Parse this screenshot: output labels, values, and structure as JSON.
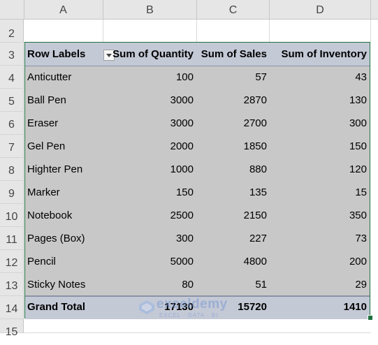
{
  "columns": [
    "A",
    "B",
    "C",
    "D"
  ],
  "rows": [
    "2",
    "3",
    "4",
    "5",
    "6",
    "7",
    "8",
    "9",
    "10",
    "11",
    "12",
    "13",
    "14",
    "15"
  ],
  "pivot": {
    "header": {
      "row_labels": "Row Labels",
      "qty": "Sum of Quantity",
      "sales": "Sum of Sales",
      "inventory": "Sum of Inventory"
    },
    "items": [
      {
        "label": "Anticutter",
        "qty": "100",
        "sales": "57",
        "inventory": "43"
      },
      {
        "label": "Ball Pen",
        "qty": "3000",
        "sales": "2870",
        "inventory": "130"
      },
      {
        "label": "Eraser",
        "qty": "3000",
        "sales": "2700",
        "inventory": "300"
      },
      {
        "label": "Gel Pen",
        "qty": "2000",
        "sales": "1850",
        "inventory": "150"
      },
      {
        "label": "Highter Pen",
        "qty": "1000",
        "sales": "880",
        "inventory": "120"
      },
      {
        "label": "Marker",
        "qty": "150",
        "sales": "135",
        "inventory": "15"
      },
      {
        "label": "Notebook",
        "qty": "2500",
        "sales": "2150",
        "inventory": "350"
      },
      {
        "label": "Pages (Box)",
        "qty": "300",
        "sales": "227",
        "inventory": "73"
      },
      {
        "label": "Pencil",
        "qty": "5000",
        "sales": "4800",
        "inventory": "200"
      },
      {
        "label": "Sticky Notes",
        "qty": "80",
        "sales": "51",
        "inventory": "29"
      }
    ],
    "total": {
      "label": "Grand Total",
      "qty": "17130",
      "sales": "15720",
      "inventory": "1410"
    }
  },
  "watermark": {
    "name": "exceldemy",
    "tagline": "EXCEL · DATA · BI"
  }
}
